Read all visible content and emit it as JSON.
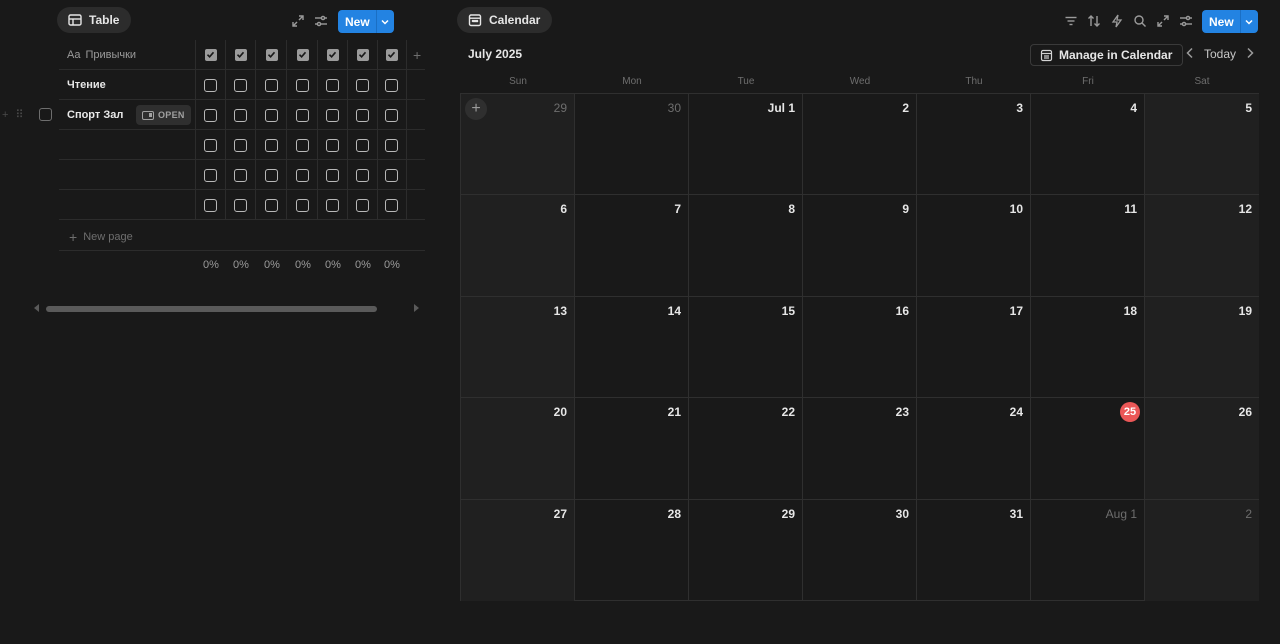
{
  "table_view": {
    "tab_label": "Table",
    "new_label": "New",
    "column_header": "Привычки",
    "column_icon_text": "Aa",
    "rows": [
      {
        "name": "Чтение"
      },
      {
        "name": "Спорт Зал",
        "open_label": "OPEN"
      },
      {
        "name": ""
      },
      {
        "name": ""
      },
      {
        "name": ""
      }
    ],
    "checkbox_columns": 7,
    "new_page_label": "New page",
    "percentages": [
      "0%",
      "0%",
      "0%",
      "0%",
      "0%",
      "0%",
      "0%"
    ]
  },
  "calendar_view": {
    "tab_label": "Calendar",
    "new_label": "New",
    "month_title": "July 2025",
    "manage_label": "Manage in Calendar",
    "today_label": "Today",
    "weekdays": [
      "Sun",
      "Mon",
      "Tue",
      "Wed",
      "Thu",
      "Fri",
      "Sat"
    ],
    "weeks": [
      [
        "29",
        "30",
        "Jul 1",
        "2",
        "3",
        "4",
        "5"
      ],
      [
        "6",
        "7",
        "8",
        "9",
        "10",
        "11",
        "12"
      ],
      [
        "13",
        "14",
        "15",
        "16",
        "17",
        "18",
        "19"
      ],
      [
        "20",
        "21",
        "22",
        "23",
        "24",
        "25",
        "26"
      ],
      [
        "27",
        "28",
        "29",
        "30",
        "31",
        "Aug 1",
        "2"
      ]
    ],
    "muted_days": [
      [
        0,
        0
      ],
      [
        0,
        1
      ],
      [
        4,
        5
      ],
      [
        4,
        6
      ]
    ],
    "today": [
      3,
      5
    ],
    "today_color": "#eb5757",
    "accent_color": "#2383e2"
  }
}
